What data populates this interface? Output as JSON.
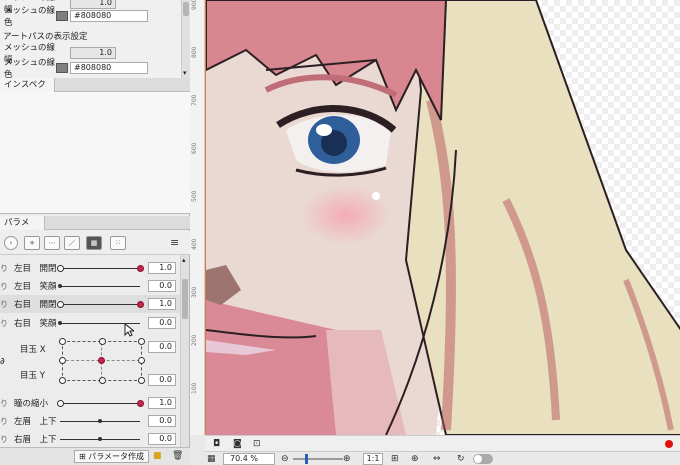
{
  "mesh_panel": {
    "top_label": "メッシュの線幅",
    "top_value": "1.0",
    "color_label": "メッシュの線色",
    "color_hex": "#808080",
    "art_path_section": "アートパスの表示設定",
    "art_width_label": "メッシュの線幅",
    "art_width_value": "1.0",
    "art_color_label": "メッシュの線色",
    "art_color_hex": "#808080"
  },
  "inspector": {
    "tab": "インスペクタ"
  },
  "parameters": {
    "tab": "パラメータ",
    "rows": [
      {
        "prefix": "り",
        "name": "左目　開閉",
        "value": "1.0"
      },
      {
        "prefix": "り",
        "name": "左目　笑顔",
        "value": "0.0"
      },
      {
        "prefix": "り",
        "name": "右目　開閉",
        "value": "1.0"
      },
      {
        "prefix": "り",
        "name": "右目　笑顔",
        "value": "0.0"
      },
      {
        "prefix": "",
        "name": "目玉 X",
        "value": "0.0"
      },
      {
        "prefix": "",
        "name": "目玉 Y",
        "value": "0.0"
      },
      {
        "prefix": "り",
        "name": "瞳の縮小",
        "value": "1.0"
      },
      {
        "prefix": "り",
        "name": "左眉　上下",
        "value": "0.0"
      },
      {
        "prefix": "り",
        "name": "右眉　上下",
        "value": "0.0"
      }
    ],
    "create_button": "パラメータ作成"
  },
  "ruler": {
    "marks": [
      "900",
      "800",
      "700",
      "600",
      "500",
      "400",
      "300",
      "200",
      "100"
    ]
  },
  "status": {
    "zoom": "70.4 %",
    "ratio_button": "1:1"
  },
  "colors": {
    "accent": "#c8244a",
    "canvas_border": "#e07a3c"
  }
}
